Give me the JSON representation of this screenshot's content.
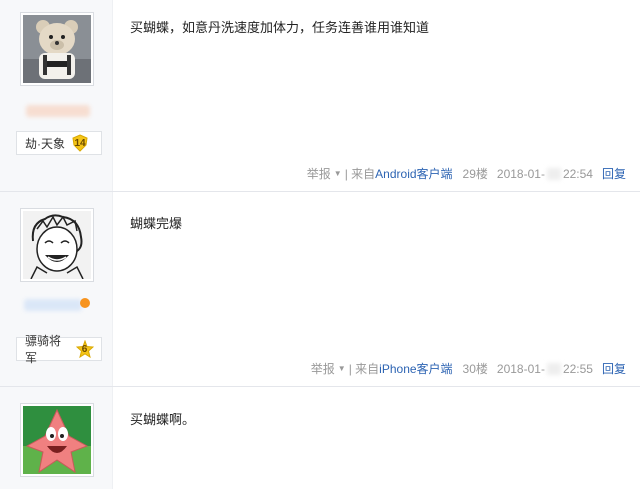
{
  "posts": [
    {
      "content": "买蝴蝶，如意丹洗速度加体力，任务连善谁用谁知道",
      "user_title": "劫·天象",
      "level": "14",
      "report_label": "举报",
      "source_prefix": "| 来自",
      "source_client": "Android客户端",
      "floor": "29楼",
      "date_prefix": "2018-01-",
      "time": "22:54",
      "reply_label": "回复"
    },
    {
      "content": "蝴蝶完爆",
      "user_title": "骠骑将军",
      "level": "6",
      "report_label": "举报",
      "source_prefix": "| 来自",
      "source_client": "iPhone客户端",
      "floor": "30楼",
      "date_prefix": "2018-01-",
      "time": "22:55",
      "reply_label": "回复"
    },
    {
      "content": "买蝴蝶啊。"
    }
  ],
  "colors": {
    "link": "#2d64b3",
    "meta": "#999999",
    "sidebar": "#f7f8fa",
    "badge_gold": "#f5c518"
  }
}
